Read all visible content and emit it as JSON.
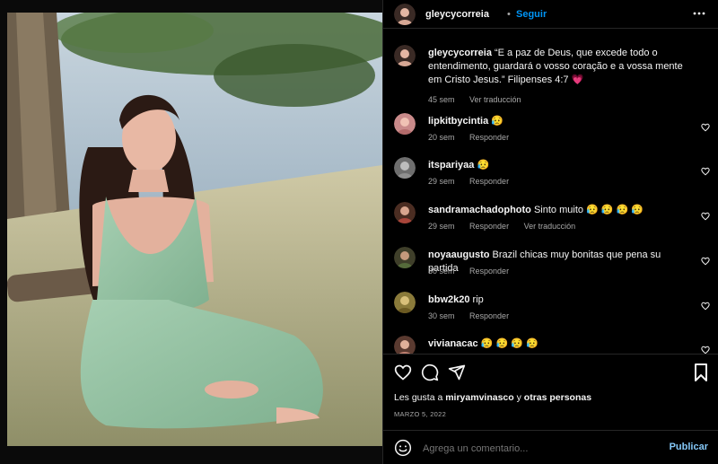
{
  "post": {
    "username": "gleycycorreia",
    "dot": "•",
    "follow_label": "Seguir",
    "more_icon": "more-horizontal-icon"
  },
  "caption": {
    "username": "gleycycorreia",
    "text": "“E a paz de Deus, que excede todo o entendimento, guardará o vosso coração e a vossa mente em Cristo Jesus.” Filipenses 4:7",
    "emoji": "💗",
    "time": "45 sem",
    "translate": "Ver traducción"
  },
  "comments": [
    {
      "username": "lipkitbycintia",
      "text": "😥",
      "time": "20 sem",
      "reply": "Responder",
      "translate": ""
    },
    {
      "username": "itspariyaa",
      "text": "😥",
      "time": "29 sem",
      "reply": "Responder",
      "translate": ""
    },
    {
      "username": "sandramachadophoto",
      "text": "Sinto muito 😥 😥 😥 😥",
      "time": "29 sem",
      "reply": "Responder",
      "translate": "Ver traducción"
    },
    {
      "username": "noyaaugusto",
      "text": "Brazil chicas muy bonitas que pena su partida",
      "time": "30 sem",
      "reply": "Responder",
      "translate": ""
    },
    {
      "username": "bbw2k20",
      "text": "rip",
      "time": "30 sem",
      "reply": "Responder",
      "translate": ""
    },
    {
      "username": "vivianacac",
      "text": "😥 😥 😥 😥",
      "time": "",
      "reply": "",
      "translate": ""
    }
  ],
  "likes": {
    "prefix": "Les gusta a",
    "user": "miryamvinasco",
    "conj": "y",
    "others": "otras personas"
  },
  "date": "MARZO 5, 2022",
  "add_comment": {
    "placeholder": "Agrega un comentario...",
    "publish": "Publicar"
  },
  "colors": {
    "accent": "#0095f6",
    "background": "#000000",
    "border": "#262626",
    "muted": "#a8a8a8"
  }
}
